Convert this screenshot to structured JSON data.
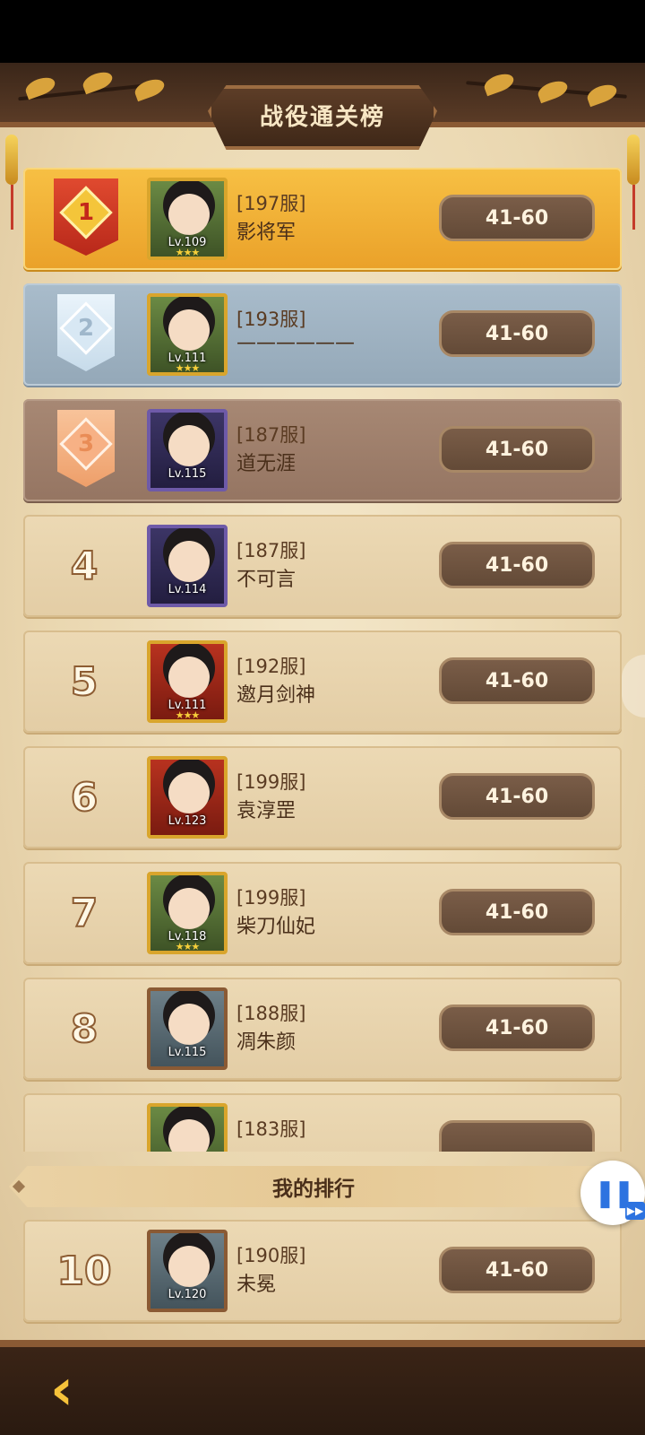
{
  "title": "战役通关榜",
  "rows": [
    {
      "rank": "1",
      "server": "[197服]",
      "name": "影将军",
      "level": "Lv.109",
      "score": "41-60"
    },
    {
      "rank": "2",
      "server": "[193服]",
      "name": "——————",
      "level": "Lv.111",
      "score": "41-60"
    },
    {
      "rank": "3",
      "server": "[187服]",
      "name": "道无涯",
      "level": "Lv.115",
      "score": "41-60"
    },
    {
      "rank": "4",
      "server": "[187服]",
      "name": "不可言",
      "level": "Lv.114",
      "score": "41-60"
    },
    {
      "rank": "5",
      "server": "[192服]",
      "name": "邀月剑神",
      "level": "Lv.111",
      "score": "41-60"
    },
    {
      "rank": "6",
      "server": "[199服]",
      "name": "袁淳罡",
      "level": "Lv.123",
      "score": "41-60"
    },
    {
      "rank": "7",
      "server": "[199服]",
      "name": "柴刀仙妃",
      "level": "Lv.118",
      "score": "41-60"
    },
    {
      "rank": "8",
      "server": "[188服]",
      "name": "凋朱颜",
      "level": "Lv.115",
      "score": "41-60"
    },
    {
      "rank": "",
      "server": "[183服]",
      "name": "",
      "level": "",
      "score": ""
    }
  ],
  "my_rank_label": "我的排行",
  "my_row": {
    "rank": "10",
    "server": "[190服]",
    "name": "未冕",
    "level": "Lv.120",
    "score": "41-60"
  },
  "stars": "★★★",
  "pause_symbol": "❚❚",
  "ff_symbol": "▶▶",
  "back_symbol": "‹"
}
